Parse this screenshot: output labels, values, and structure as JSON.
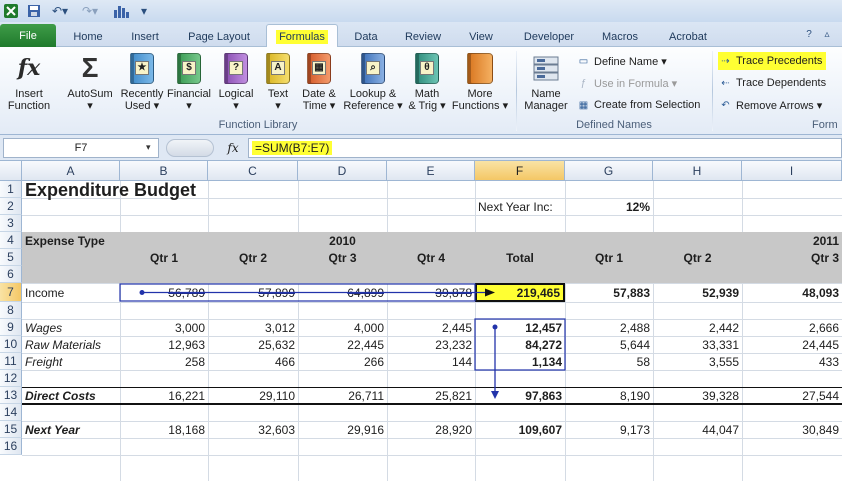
{
  "window": {
    "qat_icons": [
      "excel-logo-icon",
      "save-icon",
      "undo-icon",
      "redo-icon",
      "chart-icon",
      "customize-icon"
    ]
  },
  "tabs": {
    "file": "File",
    "items": [
      "Home",
      "Insert",
      "Page Layout",
      "Formulas",
      "Data",
      "Review",
      "View",
      "Developer",
      "Macros",
      "Acrobat"
    ],
    "active": "Formulas"
  },
  "ribbon": {
    "function_library": {
      "label": "Function Library",
      "buttons": [
        {
          "line1": "Insert",
          "line2": "Function",
          "icon": "fx-icon"
        },
        {
          "line1": "AutoSum",
          "line2": "▾",
          "icon": "sigma-icon"
        },
        {
          "line1": "Recently",
          "line2": "Used ▾",
          "icon": "star-book-icon"
        },
        {
          "line1": "Financial",
          "line2": "▾",
          "icon": "money-book-icon"
        },
        {
          "line1": "Logical",
          "line2": "▾",
          "icon": "question-book-icon"
        },
        {
          "line1": "Text",
          "line2": "▾",
          "icon": "text-book-icon"
        },
        {
          "line1": "Date &",
          "line2": "Time ▾",
          "icon": "calendar-book-icon"
        },
        {
          "line1": "Lookup &",
          "line2": "Reference ▾",
          "icon": "magnifier-book-icon"
        },
        {
          "line1": "Math",
          "line2": "& Trig ▾",
          "icon": "theta-book-icon"
        },
        {
          "line1": "More",
          "line2": "Functions ▾",
          "icon": "more-books-icon"
        }
      ]
    },
    "defined_names": {
      "label": "Defined Names",
      "name_manager": {
        "line1": "Name",
        "line2": "Manager"
      },
      "define_name": "Define Name ▾",
      "use_in_formula": "Use in Formula ▾",
      "create_from_selection": "Create from Selection"
    },
    "formula_auditing": {
      "label": "Form",
      "trace_precedents": "Trace Precedents",
      "trace_dependents": "Trace Dependents",
      "remove_arrows": "Remove Arrows ▾"
    }
  },
  "formula_bar": {
    "name_box": "F7",
    "fx": "fx",
    "formula": "=SUM(B7:E7)"
  },
  "sheet": {
    "columns": [
      "A",
      "B",
      "C",
      "D",
      "E",
      "F",
      "G",
      "H",
      "I"
    ],
    "selected_column": "F",
    "rows": [
      "1",
      "2",
      "3",
      "4",
      "5",
      "6",
      "7",
      "8",
      "9",
      "10",
      "11",
      "12",
      "13",
      "14",
      "15",
      "16"
    ],
    "selected_row": "7",
    "title": "Expenditure Budget",
    "next_year_label": "Next Year Inc:",
    "next_year_value": "12%",
    "header": {
      "expense_type": "Expense Type",
      "year_2010": "2010",
      "year_2011": "2011",
      "qtrs": [
        "Qtr 1",
        "Qtr 2",
        "Qtr 3",
        "Qtr 4",
        "Total",
        "Qtr 1",
        "Qtr 2",
        "Qtr 3"
      ]
    },
    "data_rows": [
      {
        "row": "7",
        "label": "Income",
        "values": [
          "56,789",
          "57,899",
          "64,899",
          "39,878",
          "219,465",
          "57,883",
          "52,939",
          "48,093"
        ]
      },
      {
        "row": "9",
        "label": "Wages",
        "values": [
          "3,000",
          "3,012",
          "4,000",
          "2,445",
          "12,457",
          "2,488",
          "2,442",
          "2,666"
        ]
      },
      {
        "row": "10",
        "label": "Raw Materials",
        "values": [
          "12,963",
          "25,632",
          "22,445",
          "23,232",
          "84,272",
          "5,644",
          "33,331",
          "24,445"
        ]
      },
      {
        "row": "11",
        "label": "Freight",
        "values": [
          "258",
          "466",
          "266",
          "144",
          "1,134",
          "58",
          "3,555",
          "433"
        ]
      },
      {
        "row": "13",
        "label": "Direct Costs",
        "values": [
          "16,221",
          "29,110",
          "26,711",
          "25,821",
          "97,863",
          "8,190",
          "39,328",
          "27,544"
        ]
      },
      {
        "row": "15",
        "label": "Next Year",
        "values": [
          "18,168",
          "32,603",
          "29,916",
          "28,920",
          "109,607",
          "9,173",
          "44,047",
          "30,849"
        ]
      }
    ]
  },
  "colors": {
    "highlight": "#ffff33",
    "trace_arrow": "#2233aa",
    "header_band": "#c8c8c8"
  }
}
